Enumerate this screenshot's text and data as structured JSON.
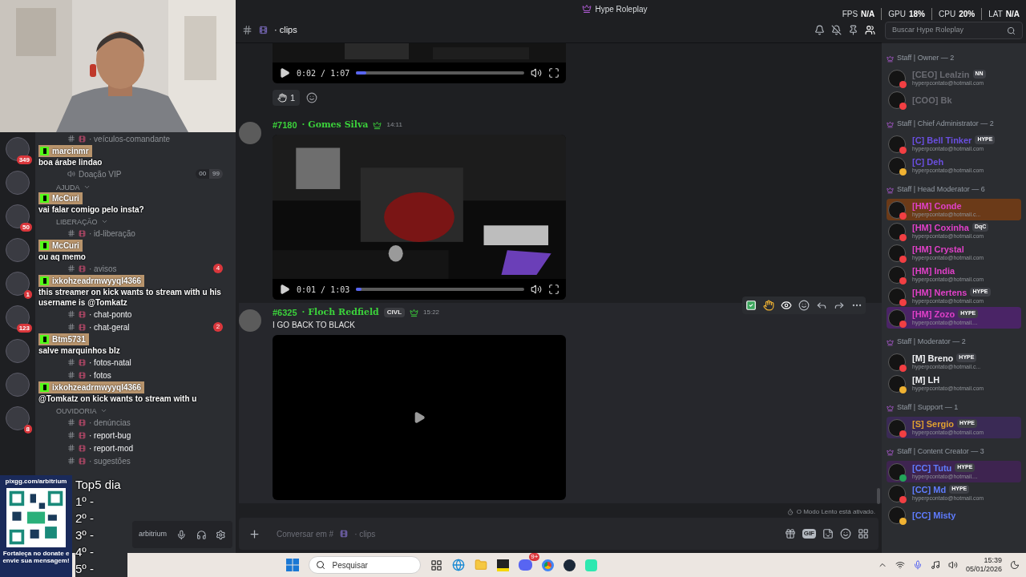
{
  "title_bar": {
    "title": "Hype Roleplay",
    "stats": [
      {
        "label": "FPS",
        "value": "N/A"
      },
      {
        "label": "GPU",
        "value": "18%"
      },
      {
        "label": "CPU",
        "value": "20%"
      },
      {
        "label": "LAT",
        "value": "N/A"
      }
    ]
  },
  "server_rail": [
    {
      "kind": "server",
      "badge": "349"
    },
    {
      "kind": "server"
    },
    {
      "kind": "server",
      "badge": "50"
    },
    {
      "kind": "server"
    },
    {
      "kind": "server",
      "badge": "1"
    },
    {
      "kind": "server",
      "badge": "123"
    },
    {
      "kind": "server"
    },
    {
      "kind": "server"
    },
    {
      "kind": "server",
      "badge": "8"
    }
  ],
  "sidebar_rows": [
    {
      "kind": "text",
      "name": "· veículos-comandante",
      "unread": false
    },
    {
      "kind": "chat",
      "user": "marcinmr",
      "text": "boa árabe lindao"
    },
    {
      "kind": "voice",
      "name": "Doação VIP",
      "counts": [
        "00",
        "99"
      ]
    },
    {
      "kind": "category",
      "name": "AJUDA"
    },
    {
      "kind": "chat",
      "user": "McCuri",
      "text": "vai falar comigo pelo insta?"
    },
    {
      "kind": "category",
      "name": "LIBERAÇÃO"
    },
    {
      "kind": "text",
      "name": "· id-liberação",
      "unread": false
    },
    {
      "kind": "chat",
      "user": "McCuri",
      "text": "ou aq memo"
    },
    {
      "kind": "text",
      "name": "· avisos",
      "unread": false,
      "badge": "4"
    },
    {
      "kind": "chat",
      "user": "ixkohzeadrmwyyql4366",
      "text": "this streamer on kick wants to stream with u his username is @Tomkatz"
    },
    {
      "kind": "text",
      "name": "· chat-ponto",
      "unread": true
    },
    {
      "kind": "text",
      "name": "· chat-geral",
      "unread": true,
      "badge": "2"
    },
    {
      "kind": "chat",
      "user": "Btm5731",
      "text": "salve marquinhos blz"
    },
    {
      "kind": "text",
      "name": "· fotos-natal",
      "unread": true
    },
    {
      "kind": "text",
      "name": "· fotos",
      "unread": true
    },
    {
      "kind": "chat",
      "user": "ixkohzeadrmwyyql4366",
      "text": "@Tomkatz on kick wants to stream with u"
    },
    {
      "kind": "category",
      "name": "OUVIDORIA"
    },
    {
      "kind": "text",
      "name": "· denúncias",
      "unread": false
    },
    {
      "kind": "text",
      "name": "· report-bug",
      "unread": true
    },
    {
      "kind": "text",
      "name": "· report-mod",
      "unread": true
    },
    {
      "kind": "text",
      "name": "· sugestões",
      "unread": false
    }
  ],
  "donation_panel": {
    "url": "pixgg.com/arbitrium",
    "caption": "Fortaleça no donate e envie sua mensagem!",
    "top_title": "Top5 dia",
    "top_ranks": [
      "1º -",
      "2º -",
      "3º -",
      "4º -",
      "5º -"
    ]
  },
  "user_panel": {
    "name": "arbitrium"
  },
  "channel_header": {
    "name": "· clips"
  },
  "messages": [
    {
      "kind": "video_tail",
      "time": "0:02 / 1:07",
      "level": 0.06,
      "reaction_count": "1"
    },
    {
      "kind": "video",
      "tag": "#7180",
      "author": "· Gomes Silva",
      "timestamp": "14:11",
      "time": "0:01 / 1:03",
      "level": 0.03
    },
    {
      "kind": "black_video",
      "tag": "#6325",
      "author": "· Floch Redfield",
      "badge": "CIVL",
      "timestamp": "15:22",
      "text": "I GO BACK TO BLACK",
      "hovered": true
    }
  ],
  "slow_mode": "O Modo Lento está ativado.",
  "composer": {
    "placeholder": [
      "Conversar em #",
      "· clips"
    ],
    "gif": "GIF"
  },
  "member_search": {
    "placeholder": "Buscar Hype Roleplay"
  },
  "member_groups": [
    {
      "title": "Staff | Owner — 2",
      "members": [
        {
          "name": "[CEO] Lealzin",
          "color": "#6a6b72",
          "badge": "NN",
          "status": {
            "color": "#f23f43"
          },
          "sub": "hyperpcontato@hotmail.com"
        },
        {
          "name": "[COO] Bk",
          "color": "#6a6b72",
          "status": {
            "color": "#f23f43"
          }
        }
      ]
    },
    {
      "title": "Staff | Chief Administrator — 2",
      "members": [
        {
          "name": "[C] Bell Tinker",
          "color": "#6a4fe0",
          "badge": "HYPE",
          "status": {
            "color": "#f23f43"
          },
          "sub": "hyperpcontato@hotmail.com"
        },
        {
          "name": "[C] Deh",
          "color": "#6a4fe0",
          "status": {
            "color": "#f0b232"
          },
          "sub": "hyperpcontato@hotmail.com"
        }
      ]
    },
    {
      "title": "Staff | Head Moderator — 6",
      "members": [
        {
          "name": "[HM] Conde",
          "color": "#e040c8",
          "status": {
            "color": "#f23f43"
          },
          "sub": "hyperpcontato@hotmail.c...",
          "banner": {
            "color": "#6b3a18"
          }
        },
        {
          "name": "[HM] Coxinha",
          "color": "#e040c8",
          "badge": "DqC",
          "status": {
            "color": "#f23f43"
          },
          "sub": "hyperpcontato@hotmail.com"
        },
        {
          "name": "[HM] Crystal",
          "color": "#e040c8",
          "status": {
            "color": "#f23f43"
          },
          "sub": "hyperpcontato@hotmail.com"
        },
        {
          "name": "[HM] India",
          "color": "#e040c8",
          "status": {
            "color": "#f23f43"
          },
          "sub": "hyperpcontato@hotmail.com"
        },
        {
          "name": "[HM] Nertens",
          "color": "#e040c8",
          "badge": "HYPE",
          "status": {
            "color": "#f23f43"
          },
          "sub": "hyperpcontato@hotmail.com"
        },
        {
          "name": "[HM] Zozo",
          "color": "#e040c8",
          "badge": "HYPE",
          "status": {
            "color": "#f23f43"
          },
          "sub": "hyperpcontato@hotmail....",
          "banner": {
            "color": "#4a2466"
          }
        }
      ]
    },
    {
      "title": "Staff | Moderator — 2",
      "members": [
        {
          "name": "[M] Breno",
          "color": "#f2f3f5",
          "badge": "HYPE",
          "status": {
            "color": "#f23f43"
          },
          "sub": "hyperpcontato@hotmail.c..."
        },
        {
          "name": "[M] LH",
          "color": "#f2f3f5",
          "status": {
            "color": "#f0b232"
          },
          "sub": "hyperpcontato@hotmail.com"
        }
      ]
    },
    {
      "title": "Staff | Support — 1",
      "members": [
        {
          "name": "[S] Sergio",
          "color": "#e0a030",
          "badge": "HYPE",
          "status": {
            "color": "#f23f43"
          },
          "sub": "hyperpcontato@hotmail.com",
          "banner": {
            "color": "#3a2a55"
          }
        }
      ]
    },
    {
      "title": "Staff | Content Creator — 3",
      "members": [
        {
          "name": "[CC] Tutu",
          "color": "#5f7cff",
          "badge": "HYPE",
          "status": {
            "color": "#23a55a"
          },
          "sub": "hyperpcontato@hotmail....",
          "banner": {
            "color": "#3e2450"
          }
        },
        {
          "name": "[CC] Md",
          "color": "#5f7cff",
          "badge": "HYPE",
          "status": {
            "color": "#f23f43"
          },
          "sub": "hyperpcontato@hotmail.com"
        },
        {
          "name": "[CC] Misty",
          "color": "#5f7cff",
          "status": {
            "color": "#f0b232"
          }
        }
      ]
    }
  ],
  "taskbar": {
    "search": "Pesquisar",
    "time": "15:39",
    "date": "05/01/2026",
    "discord_badge": "9+"
  }
}
